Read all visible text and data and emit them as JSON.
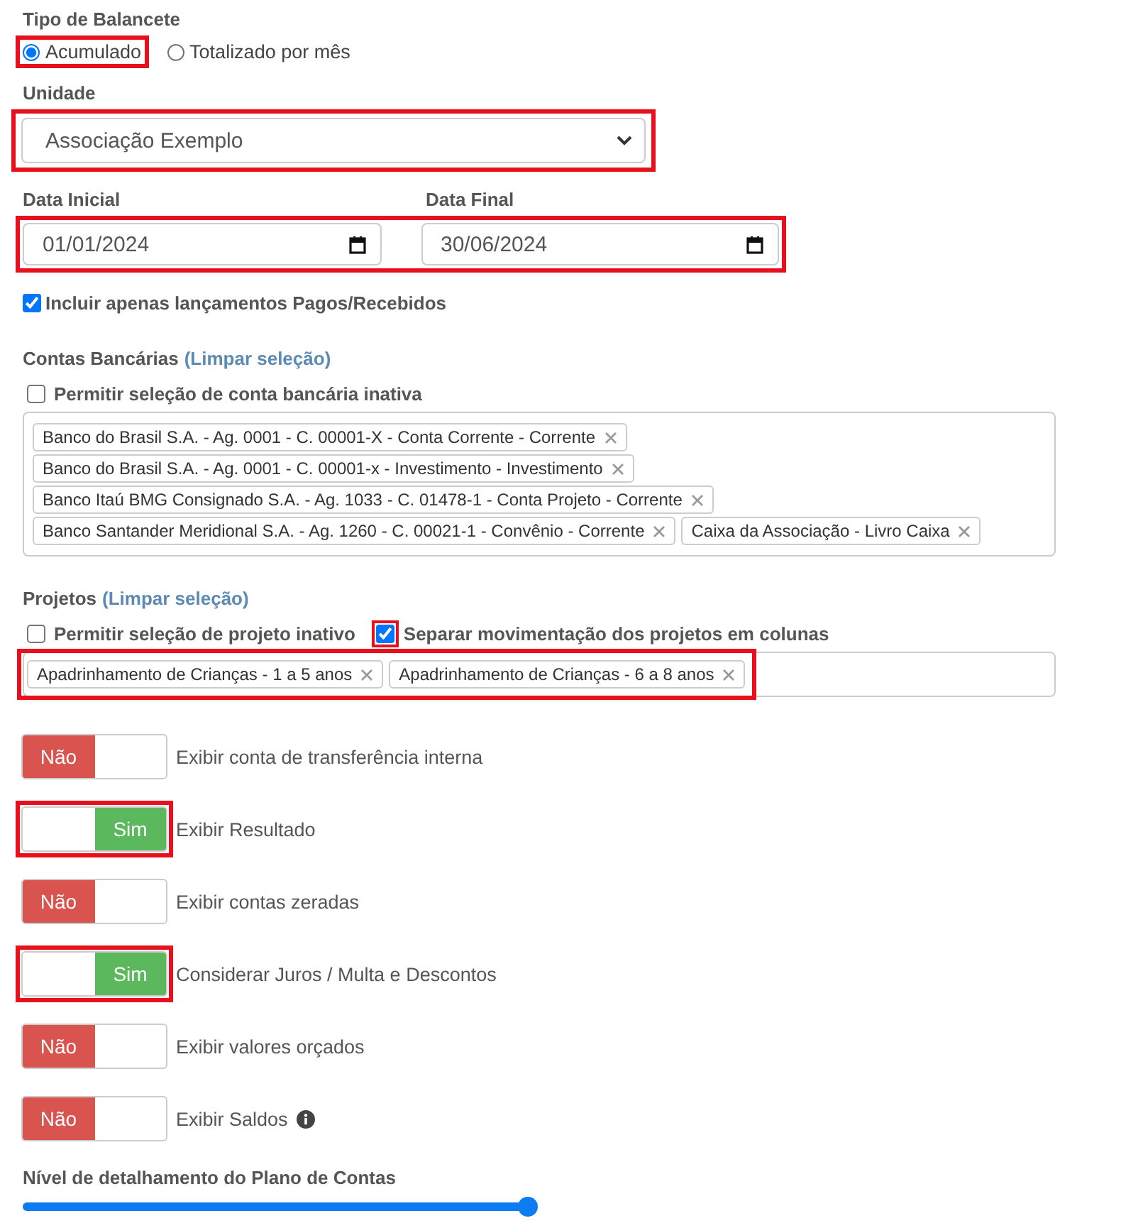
{
  "tipo_balancete": {
    "label": "Tipo de Balancete",
    "options": [
      {
        "label": "Acumulado",
        "selected": true,
        "highlighted": true
      },
      {
        "label": "Totalizado por mês",
        "selected": false,
        "highlighted": false
      }
    ]
  },
  "unidade": {
    "label": "Unidade",
    "value": "Associação Exemplo",
    "highlighted": true
  },
  "dates": {
    "highlighted": true,
    "fields": [
      {
        "label": "Data Inicial",
        "value": "01/01/2024"
      },
      {
        "label": "Data Final",
        "value": "30/06/2024"
      }
    ]
  },
  "incluir_pagos": {
    "label": "Incluir apenas lançamentos Pagos/Recebidos",
    "checked": true
  },
  "contas": {
    "label": "Contas Bancárias",
    "clear_link": "(Limpar seleção)",
    "tags_highlighted": false,
    "checkboxes": [
      {
        "label": "Permitir seleção de conta bancária inativa",
        "checked": false,
        "highlighted": false
      }
    ],
    "tags": [
      "Banco do Brasil S.A. - Ag. 0001 - C. 00001-X - Conta Corrente - Corrente",
      "Banco do Brasil S.A. - Ag. 0001 - C. 00001-x - Investimento - Investimento",
      "Banco Itaú BMG Consignado S.A. - Ag. 1033 - C. 01478-1 - Conta Projeto - Corrente",
      "Banco Santander Meridional S.A. - Ag. 1260 - C. 00021-1 - Convênio - Corrente",
      "Caixa da Associação - Livro Caixa"
    ]
  },
  "projetos": {
    "label": "Projetos",
    "clear_link": "(Limpar seleção)",
    "tags_highlighted": true,
    "checkboxes": [
      {
        "label": "Permitir seleção de projeto inativo",
        "checked": false,
        "highlighted": false
      },
      {
        "label": "Separar movimentação dos projetos em colunas",
        "checked": true,
        "highlighted": true
      }
    ],
    "tags": [
      "Apadrinhamento de Crianças - 1 a 5 anos",
      "Apadrinhamento de Crianças - 6 a 8 anos"
    ]
  },
  "toggles": [
    {
      "label": "Exibir conta de transferência interna",
      "on": false,
      "state_label": "Não",
      "highlighted": false,
      "info": false
    },
    {
      "label": "Exibir Resultado",
      "on": true,
      "state_label": "Sim",
      "highlighted": true,
      "info": false
    },
    {
      "label": "Exibir contas zeradas",
      "on": false,
      "state_label": "Não",
      "highlighted": false,
      "info": false
    },
    {
      "label": "Considerar Juros / Multa e Descontos",
      "on": true,
      "state_label": "Sim",
      "highlighted": true,
      "info": false
    },
    {
      "label": "Exibir valores orçados",
      "on": false,
      "state_label": "Não",
      "highlighted": false,
      "info": false
    },
    {
      "label": "Exibir Saldos",
      "on": false,
      "state_label": "Não",
      "highlighted": false,
      "info": true
    }
  ],
  "slider": {
    "label": "Nível de detalhamento do Plano de Contas",
    "level": 1
  }
}
